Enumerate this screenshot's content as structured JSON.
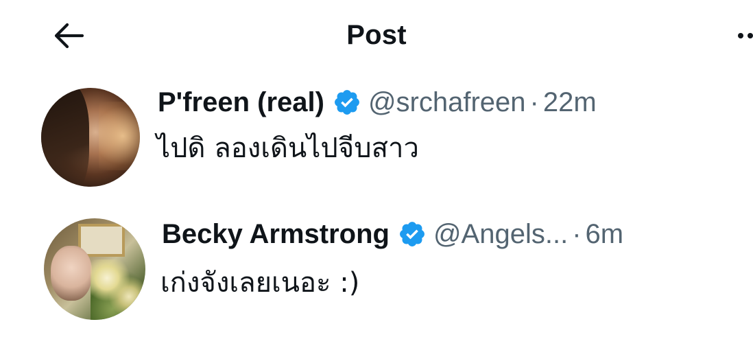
{
  "header": {
    "title": "Post"
  },
  "posts": [
    {
      "display_name": "P'freen (real)",
      "handle": "@srchafreen",
      "separator": "·",
      "time": "22m",
      "text": "ไปดิ ลองเดินไปจีบสาว",
      "verified": true
    },
    {
      "display_name": "Becky Armstrong",
      "handle": "@Angels...",
      "separator": "·",
      "time": "6m",
      "text": "เก่งจังเลยเนอะ :)",
      "verified": true
    }
  ],
  "colors": {
    "text_primary": "#0f1419",
    "text_secondary": "#536471",
    "verified_blue": "#1d9bf0"
  },
  "icons": {
    "back": "arrow-left-icon",
    "more": "more-horizontal-icon",
    "verified": "verified-badge-icon"
  }
}
